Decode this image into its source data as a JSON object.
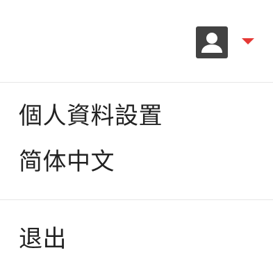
{
  "header": {
    "avatar_icon": "account-box-icon",
    "dropdown_icon": "caret-down-icon",
    "accent_color": "#e53935"
  },
  "menu": {
    "items": [
      {
        "label": "個人資料設置"
      },
      {
        "label": "简体中文"
      }
    ],
    "logout_label": "退出"
  }
}
